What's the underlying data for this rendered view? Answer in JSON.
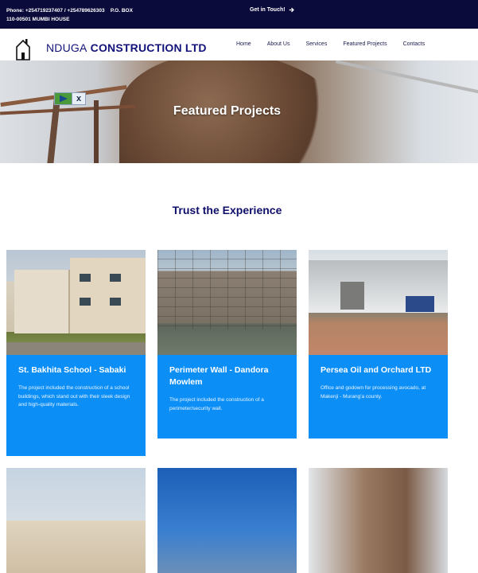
{
  "topbar": {
    "phone": "Phone: +254719237407 / +254789626303",
    "pobox": "P.O. BOX",
    "address": "110-00501 MUMBI HOUSE",
    "cta_label": "Get in Touch!",
    "cta_icon": "arrow-right-icon"
  },
  "header": {
    "brand_part1": "NDUGA",
    "brand_part2": "CONSTRUCTION LTD",
    "logo_icon": "house-icon",
    "nav": [
      "Home",
      "About Us",
      "Services",
      "Featured Projects",
      "Contacts"
    ]
  },
  "hero": {
    "title": "Featured Projects",
    "media_controls": {
      "play_icon": "play-icon",
      "close_icon": "close-icon",
      "close_glyph": "x"
    }
  },
  "section": {
    "title": "Trust the Experience"
  },
  "projects": [
    {
      "title": "St. Bakhita School - Sabaki",
      "description": "The project included the construction of a school buildings, which stand out with their sleek design and high-quality materials."
    },
    {
      "title": "Perimeter Wall - Dandora Mowlem",
      "description": "The project included the construction of a perimeter/security wall."
    },
    {
      "title": "Persea Oil and Orchard LTD",
      "description": "Office and godown for processing avocado, at Makenji - Murang'a county."
    }
  ],
  "colors": {
    "topbar_bg": "#0b0b3b",
    "brand": "#12127a",
    "card_bg": "#0c8ef7",
    "section_title": "#0f0f6b"
  }
}
